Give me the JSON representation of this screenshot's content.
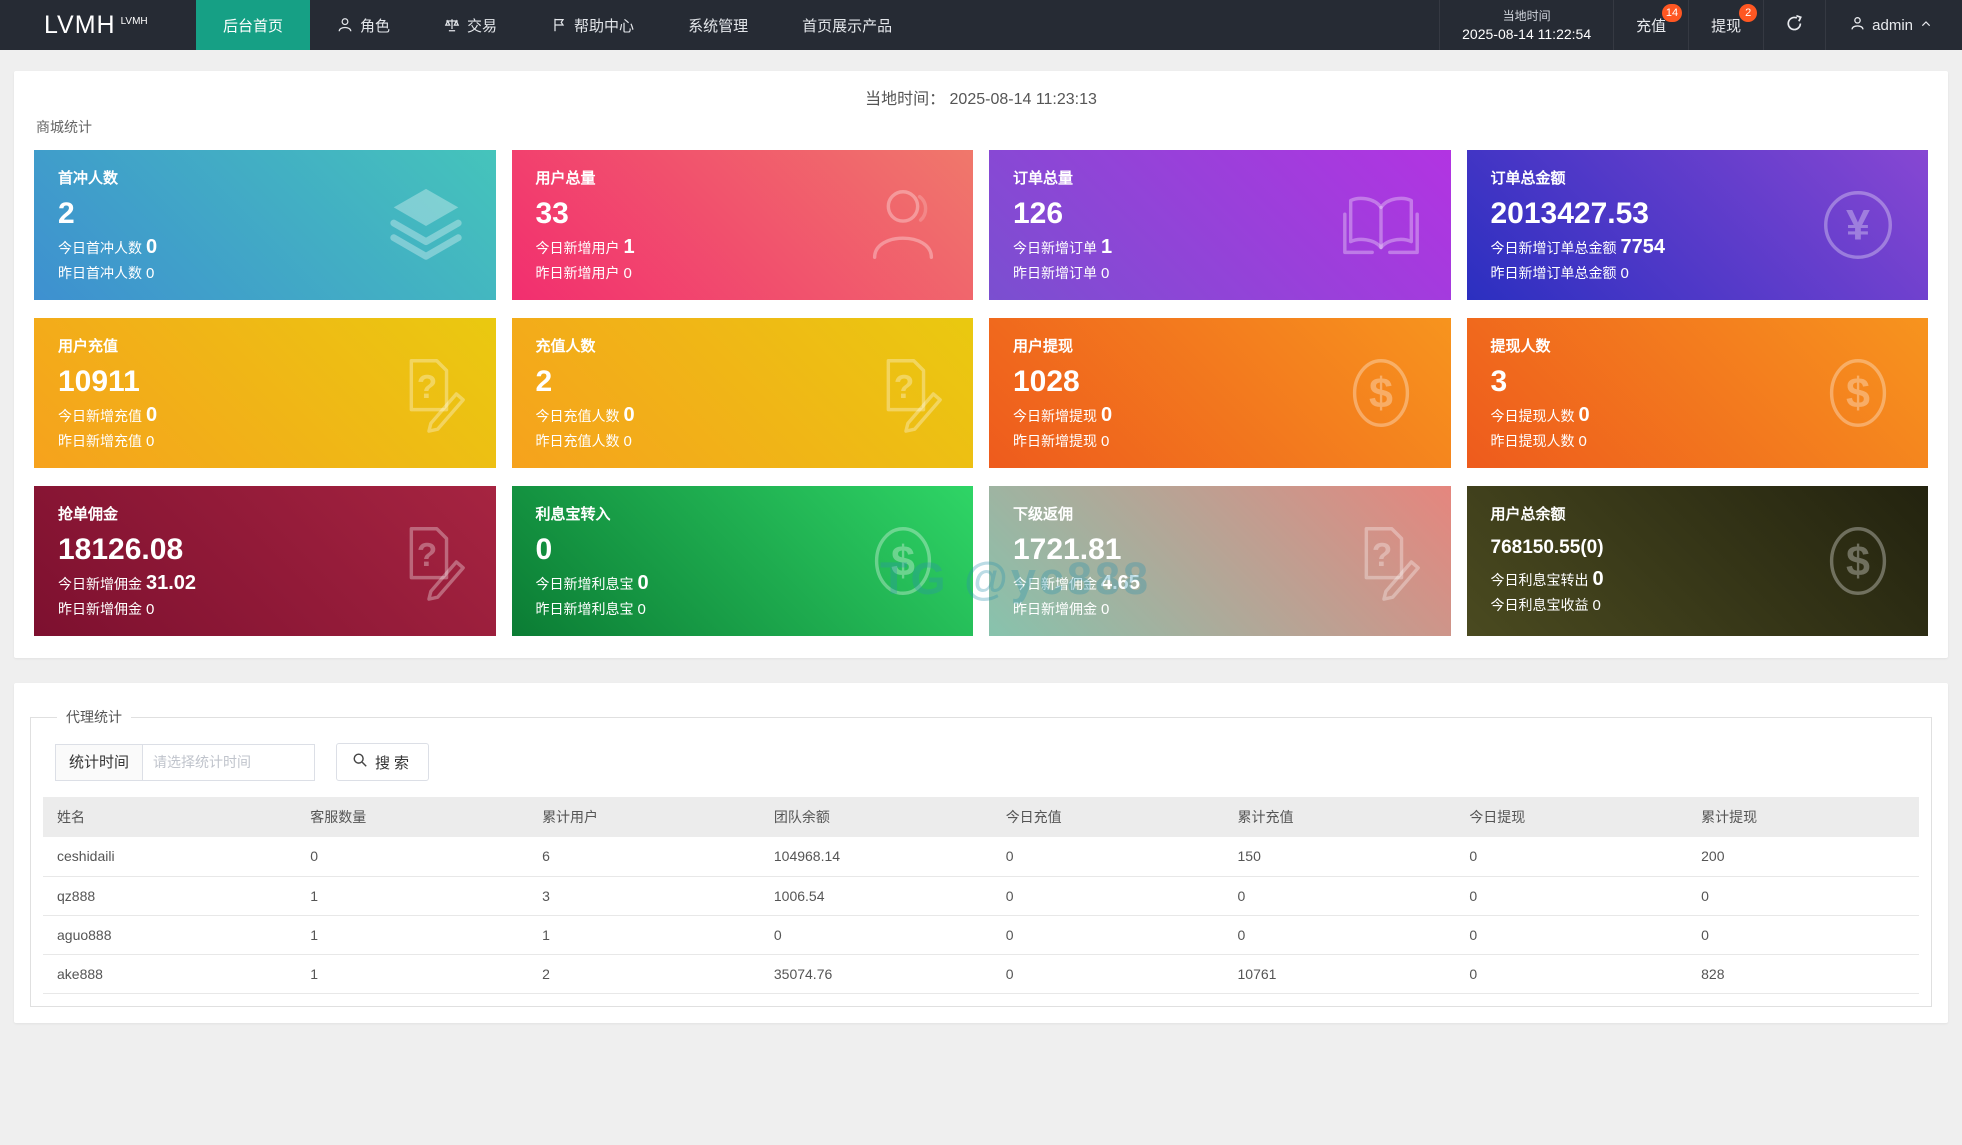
{
  "topbar": {
    "logo": "LVMH",
    "logo_sup": "LVMH",
    "nav": [
      {
        "label": "后台首页",
        "icon": null,
        "active": true
      },
      {
        "label": "角色",
        "icon": "person-icon",
        "active": false
      },
      {
        "label": "交易",
        "icon": "scales-icon",
        "active": false
      },
      {
        "label": "帮助中心",
        "icon": "flag-icon",
        "active": false
      },
      {
        "label": "系统管理",
        "icon": null,
        "active": false
      },
      {
        "label": "首页展示产品",
        "icon": null,
        "active": false
      }
    ],
    "local_time_label": "当地时间",
    "local_time_value": "2025-08-14 11:22:54",
    "recharge_label": "充值",
    "recharge_badge": "14",
    "withdraw_label": "提现",
    "withdraw_badge": "2",
    "user_name": "admin",
    "accent_color": "#16a085",
    "badge_color": "#ff5722"
  },
  "stats_panel": {
    "time_label": "当地时间：",
    "time_value": "2025-08-14 11:23:13",
    "section_title": "商城统计",
    "watermark": "TG @yc888",
    "cards": [
      {
        "title": "首冲人数",
        "value": "2",
        "today_label": "今日首冲人数",
        "today_value": "0",
        "yesterday_label": "昨日首冲人数",
        "yesterday_value": "0",
        "icon": "layers-icon",
        "colors": [
          "#3e90d0",
          "#45c4bb"
        ]
      },
      {
        "title": "用户总量",
        "value": "33",
        "today_label": "今日新增用户",
        "today_value": "1",
        "yesterday_label": "昨日新增用户",
        "yesterday_value": "0",
        "icon": "user-icon",
        "colors": [
          "#f22e6f",
          "#f0786b"
        ]
      },
      {
        "title": "订单总量",
        "value": "126",
        "today_label": "今日新增订单",
        "today_value": "1",
        "yesterday_label": "昨日新增订单",
        "yesterday_value": "0",
        "icon": "book-icon",
        "colors": [
          "#7a4fd0",
          "#b234e2"
        ]
      },
      {
        "title": "订单总金额",
        "value": "2013427.53",
        "today_label": "今日新增订单总金额",
        "today_value": "7754",
        "yesterday_label": "昨日新增订单总金额",
        "yesterday_value": "0",
        "icon": "yen-circle-icon",
        "colors": [
          "#2b2fc0",
          "#8747d3"
        ]
      },
      {
        "title": "用户充值",
        "value": "10911",
        "today_label": "今日新增充值",
        "today_value": "0",
        "yesterday_label": "昨日新增充值",
        "yesterday_value": "0",
        "icon": "edit-doc-icon",
        "colors": [
          "#f6a21d",
          "#eac910"
        ]
      },
      {
        "title": "充值人数",
        "value": "2",
        "today_label": "今日充值人数",
        "today_value": "0",
        "yesterday_label": "昨日充值人数",
        "yesterday_value": "0",
        "icon": "edit-doc-icon",
        "colors": [
          "#f6a21d",
          "#eac910"
        ]
      },
      {
        "title": "用户提现",
        "value": "1028",
        "today_label": "今日新增提现",
        "today_value": "0",
        "yesterday_label": "昨日新增提现",
        "yesterday_value": "0",
        "icon": "dollar-circle-icon",
        "colors": [
          "#ee5b1d",
          "#f7941e"
        ]
      },
      {
        "title": "提现人数",
        "value": "3",
        "today_label": "今日提现人数",
        "today_value": "0",
        "yesterday_label": "昨日提现人数",
        "yesterday_value": "0",
        "icon": "dollar-circle-icon",
        "colors": [
          "#ee5b1d",
          "#f7941e"
        ]
      },
      {
        "title": "抢单佣金",
        "value": "18126.08",
        "today_label": "今日新增佣金",
        "today_value": "31.02",
        "yesterday_label": "昨日新增佣金",
        "yesterday_value": "0",
        "icon": "edit-doc-icon",
        "colors": [
          "#7d102f",
          "#a62441"
        ]
      },
      {
        "title": "利息宝转入",
        "value": "0",
        "today_label": "今日新增利息宝",
        "today_value": "0",
        "yesterday_label": "昨日新增利息宝",
        "yesterday_value": "0",
        "icon": "dollar-circle-icon",
        "colors": [
          "#0b7c34",
          "#2fd566"
        ]
      },
      {
        "title": "下级返佣",
        "value": "1721.81",
        "today_label": "今日新增佣金",
        "today_value": "4.65",
        "yesterday_label": "昨日新增佣金",
        "yesterday_value": "0",
        "icon": "edit-doc-icon",
        "colors": [
          "#87c3ad",
          "#e5867e"
        ]
      },
      {
        "title": "用户总余额",
        "value": "768150.55(0)",
        "today_label": "今日利息宝转出",
        "today_value": "0",
        "yesterday_label": "今日利息宝收益",
        "yesterday_value": "0",
        "icon": "dollar-circle-icon",
        "colors": [
          "#4a4a20",
          "#23230f"
        ]
      }
    ]
  },
  "agent_panel": {
    "legend": "代理统计",
    "filter_label": "统计时间",
    "filter_placeholder": "请选择统计时间",
    "filter_value": "",
    "search_label": "搜索",
    "table": {
      "columns": [
        "姓名",
        "客服数量",
        "累计用户",
        "团队余额",
        "今日充值",
        "累计充值",
        "今日提现",
        "累计提现"
      ],
      "rows": [
        [
          "ceshidaili",
          "0",
          "6",
          "104968.14",
          "0",
          "150",
          "0",
          "200"
        ],
        [
          "qz888",
          "1",
          "3",
          "1006.54",
          "0",
          "0",
          "0",
          "0"
        ],
        [
          "aguo888",
          "1",
          "1",
          "0",
          "0",
          "0",
          "0",
          "0"
        ],
        [
          "ake888",
          "1",
          "2",
          "35074.76",
          "0",
          "10761",
          "0",
          "828"
        ]
      ]
    }
  }
}
